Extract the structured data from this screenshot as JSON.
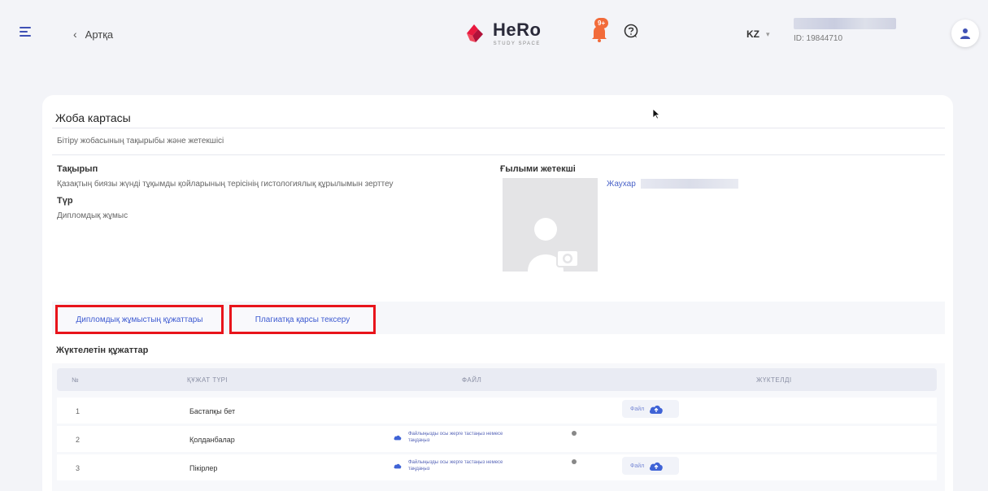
{
  "header": {
    "back_label": "Артқа",
    "logo_text": "HeRo",
    "logo_subtext": "STUDY SPACE",
    "notification_count": "9+",
    "language": "KZ",
    "user_id": "ID: 19844710"
  },
  "card": {
    "title": "Жоба картасы",
    "section_subtitle": "Бітіру жобасының тақырыбы және жетекшісі",
    "topic_label": "Тақырып",
    "topic_value": "Қазақтың биязы жүнді тұқымды қойларының терісінің гистологиялық құрылымын зерттеу",
    "type_label": "Түр",
    "type_value": "Дипломдық жұмыс",
    "supervisor_label": "Ғылыми жетекші",
    "supervisor_name": "Жаухар"
  },
  "tabs": [
    {
      "label": "Дипломдық жұмыстың құжаттары"
    },
    {
      "label": "Плагиатқа қарсы тексеру"
    }
  ],
  "documents": {
    "title": "Жүктелетін құжаттар",
    "columns": [
      "№",
      "ҚҰЖАТ ТҮРІ",
      "ФАЙЛ",
      "ЖҮКТЕЛДІ"
    ],
    "rows": [
      {
        "num": "1",
        "type": "Бастапқы бет",
        "upload_text": "",
        "file_button": "Файл"
      },
      {
        "num": "2",
        "type": "Қолданбалар",
        "upload_text": "Файлыңызды осы жерге тастаңыз немесе таңдаңыз",
        "file_button": ""
      },
      {
        "num": "3",
        "type": "Пікірлер",
        "upload_text": "Файлыңызды осы жерге тастаңыз немесе таңдаңыз",
        "file_button": "Файл"
      }
    ]
  },
  "colors": {
    "accent": "#3e5bd1",
    "highlight_border": "#e8141b",
    "badge": "#f26b3a"
  }
}
